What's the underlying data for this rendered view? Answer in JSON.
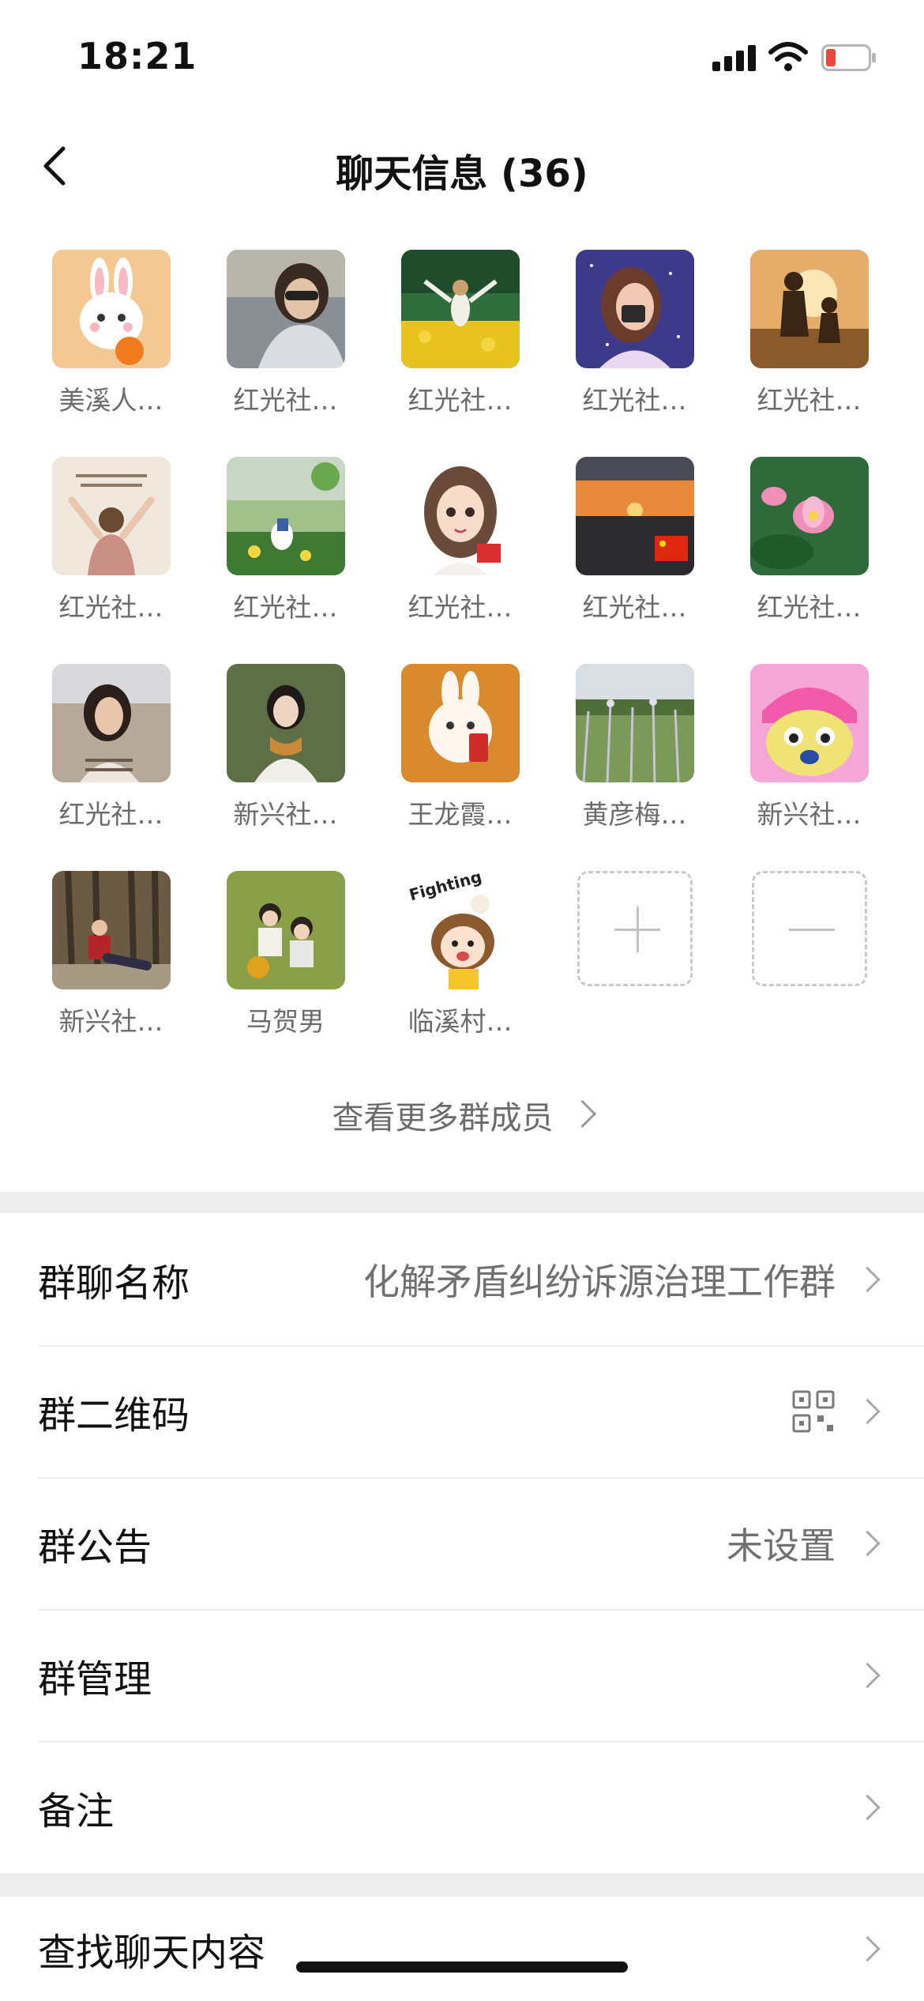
{
  "status_bar": {
    "time": "18:21"
  },
  "nav": {
    "title": "聊天信息 (36)"
  },
  "members": [
    {
      "name": "美溪人…",
      "icon": "rabbit-orange-ball"
    },
    {
      "name": "红光社…",
      "icon": "woman-sunglasses-car"
    },
    {
      "name": "红光社…",
      "icon": "girl-flower-field"
    },
    {
      "name": "红光社…",
      "icon": "painted-woman-night"
    },
    {
      "name": "红光社…",
      "icon": "couple-sunset"
    },
    {
      "name": "红光社…",
      "icon": "woman-arms-raised"
    },
    {
      "name": "红光社…",
      "icon": "duck-cartoon-field"
    },
    {
      "name": "红光社…",
      "icon": "anime-girl"
    },
    {
      "name": "红光社…",
      "icon": "sunset-flag"
    },
    {
      "name": "红光社…",
      "icon": "lotus-flowers"
    },
    {
      "name": "红光社…",
      "icon": "woman-glasses"
    },
    {
      "name": "新兴社…",
      "icon": "woman-scarf-trees"
    },
    {
      "name": "王龙霞…",
      "icon": "rabbit-red-envelope"
    },
    {
      "name": "黄彦梅…",
      "icon": "grass-field"
    },
    {
      "name": "新兴社…",
      "icon": "cartoon-chopper"
    },
    {
      "name": "新兴社…",
      "icon": "man-sitting-forest"
    },
    {
      "name": "马贺男",
      "icon": "two-kids-grass"
    },
    {
      "name": "临溪村…",
      "icon": "fighting-cartoon-girl"
    }
  ],
  "actions": {
    "add_icon": "plus-icon",
    "remove_icon": "minus-icon"
  },
  "more_members": {
    "label": "查看更多群成员"
  },
  "settings": {
    "group_name": {
      "label": "群聊名称",
      "value": "化解矛盾纠纷诉源治理工作群"
    },
    "qr_code": {
      "label": "群二维码"
    },
    "announcement": {
      "label": "群公告",
      "value": "未设置"
    },
    "management": {
      "label": "群管理"
    },
    "remark": {
      "label": "备注"
    },
    "search_chat": {
      "label": "查找聊天内容"
    }
  },
  "colors": {
    "battery_low": "#e8493c",
    "divider": "#ededed",
    "secondary_text": "#6b6b6b"
  }
}
